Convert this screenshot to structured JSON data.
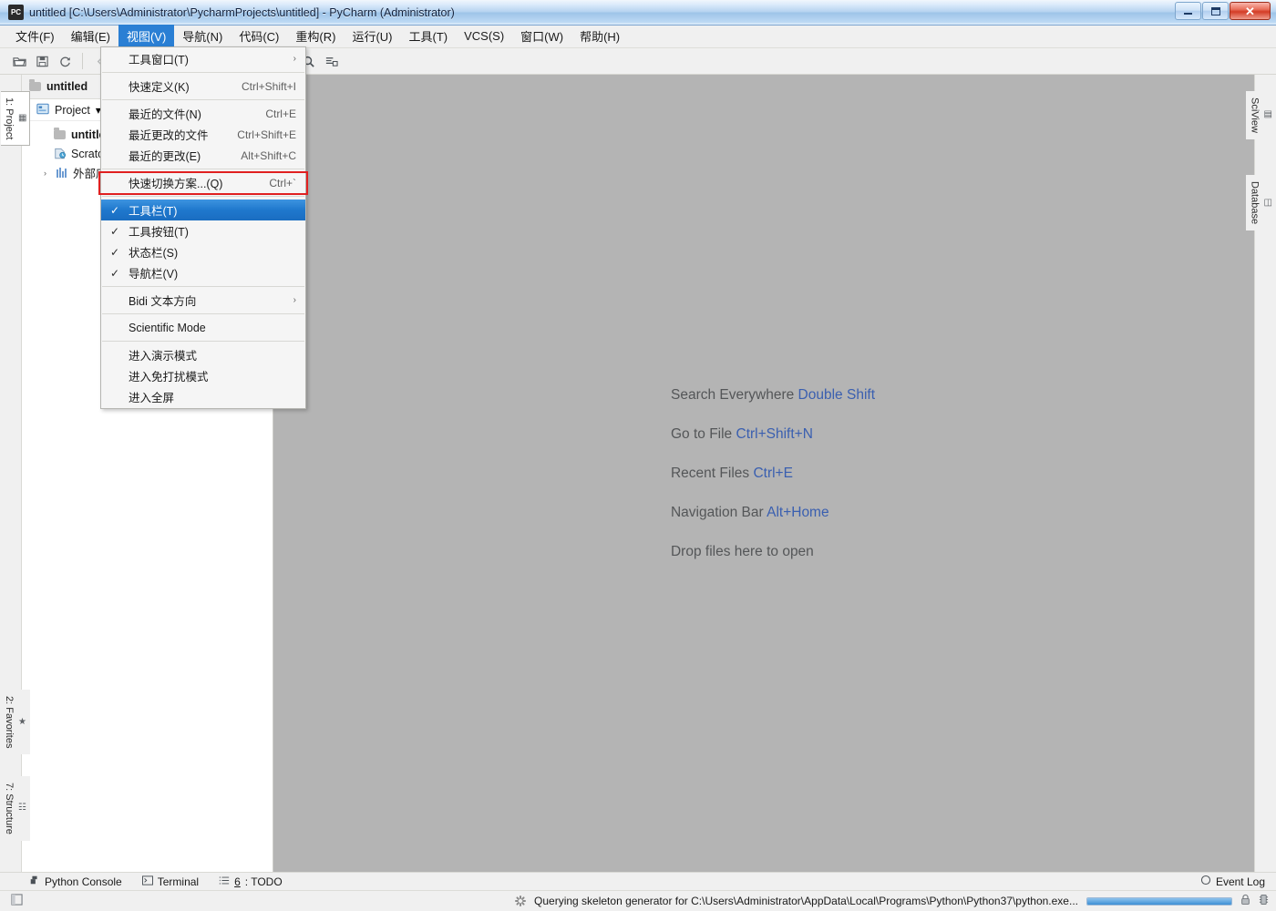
{
  "window": {
    "title": "untitled [C:\\Users\\Administrator\\PycharmProjects\\untitled] - PyCharm (Administrator)",
    "app_icon_label": "PC",
    "minimize_label": "Minimize",
    "maximize_label": "Maximize",
    "close_label": "Close",
    "accent_color": "#2a7fd4",
    "editor_bg": "#b4b4b4"
  },
  "menubar": {
    "items": [
      {
        "label": "文件(F)",
        "active": false
      },
      {
        "label": "编辑(E)",
        "active": false
      },
      {
        "label": "视图(V)",
        "active": true
      },
      {
        "label": "导航(N)",
        "active": false
      },
      {
        "label": "代码(C)",
        "active": false
      },
      {
        "label": "重构(R)",
        "active": false
      },
      {
        "label": "运行(U)",
        "active": false
      },
      {
        "label": "工具(T)",
        "active": false
      },
      {
        "label": "VCS(S)",
        "active": false
      },
      {
        "label": "窗口(W)",
        "active": false
      },
      {
        "label": "帮助(H)",
        "active": false
      }
    ]
  },
  "toolbar": {
    "buttons": [
      {
        "icon": "open-folder-icon",
        "enabled": true
      },
      {
        "icon": "save-icon",
        "enabled": true
      },
      {
        "icon": "sync-refresh-icon",
        "enabled": true
      },
      {
        "icon": "back-arrow-icon",
        "enabled": false
      },
      {
        "icon": "forward-arrow-icon",
        "enabled": false
      },
      {
        "icon": "run-icon",
        "enabled": false
      },
      {
        "icon": "debug-icon",
        "enabled": false
      },
      {
        "icon": "run-coverage-icon",
        "enabled": false
      },
      {
        "icon": "step-icon",
        "enabled": false
      },
      {
        "icon": "stop-icon",
        "enabled": false
      },
      {
        "icon": "wrench-settings-icon",
        "enabled": true
      },
      {
        "icon": "search-icon",
        "enabled": true
      },
      {
        "icon": "project-structure-icon",
        "enabled": true
      }
    ]
  },
  "view_menu": {
    "items": [
      {
        "label": "工具窗口(T)",
        "accel": "",
        "checked": false,
        "submenu": true,
        "highlighted": false,
        "separator_after": true
      },
      {
        "label": "快速定义(K)",
        "accel": "Ctrl+Shift+I",
        "checked": false,
        "submenu": false,
        "highlighted": false,
        "separator_after": true
      },
      {
        "label": "最近的文件(N)",
        "accel": "Ctrl+E",
        "checked": false,
        "submenu": false,
        "highlighted": false,
        "separator_after": false
      },
      {
        "label": "最近更改的文件",
        "accel": "Ctrl+Shift+E",
        "checked": false,
        "submenu": false,
        "highlighted": false,
        "separator_after": false
      },
      {
        "label": "最近的更改(E)",
        "accel": "Alt+Shift+C",
        "checked": false,
        "submenu": false,
        "highlighted": false,
        "separator_after": true
      },
      {
        "label": "快速切换方案...(Q)",
        "accel": "Ctrl+`",
        "checked": false,
        "submenu": false,
        "highlighted": false,
        "separator_after": true
      },
      {
        "label": "工具栏(T)",
        "accel": "",
        "checked": true,
        "submenu": false,
        "highlighted": true,
        "separator_after": false
      },
      {
        "label": "工具按钮(T)",
        "accel": "",
        "checked": true,
        "submenu": false,
        "highlighted": false,
        "separator_after": false
      },
      {
        "label": "状态栏(S)",
        "accel": "",
        "checked": true,
        "submenu": false,
        "highlighted": false,
        "separator_after": false
      },
      {
        "label": "导航栏(V)",
        "accel": "",
        "checked": true,
        "submenu": false,
        "highlighted": false,
        "separator_after": true
      },
      {
        "label": "Bidi 文本方向",
        "accel": "",
        "checked": false,
        "submenu": true,
        "highlighted": false,
        "separator_after": true
      },
      {
        "label": "Scientific Mode",
        "accel": "",
        "checked": false,
        "submenu": false,
        "highlighted": false,
        "separator_after": true
      },
      {
        "label": "进入演示模式",
        "accel": "",
        "checked": false,
        "submenu": false,
        "highlighted": false,
        "separator_after": false
      },
      {
        "label": "进入免打扰模式",
        "accel": "",
        "checked": false,
        "submenu": false,
        "highlighted": false,
        "separator_after": false
      },
      {
        "label": "进入全屏",
        "accel": "",
        "checked": false,
        "submenu": false,
        "highlighted": false,
        "separator_after": false
      }
    ],
    "highlight_color": "#1f78cd",
    "annotation_box_color": "#e02020"
  },
  "left_strip": {
    "items": [
      {
        "label": "1: Project",
        "icon": "project-window-icon",
        "selected": true
      },
      {
        "label": "2: Favorites",
        "icon": "star-icon",
        "selected": false
      },
      {
        "label": "7: Structure",
        "icon": "structure-icon",
        "selected": false
      }
    ]
  },
  "right_strip": {
    "items": [
      {
        "label": "SciView",
        "icon": "sciview-icon"
      },
      {
        "label": "Database",
        "icon": "database-icon"
      }
    ]
  },
  "project_panel": {
    "header_title": "untitled",
    "header_icon": "folder-icon",
    "tab_label": "Project",
    "tab_icon": "project-icon",
    "tree": [
      {
        "label": "untitled",
        "icon": "folder-icon",
        "depth": 1,
        "bold": true,
        "arrow": ""
      },
      {
        "label": "Scratches and Consoles",
        "icon": "scratch-icon",
        "depth": 1,
        "bold": false,
        "arrow": ""
      },
      {
        "label": "外部库",
        "icon": "library-icon",
        "depth": 0,
        "bold": false,
        "arrow": "›"
      }
    ]
  },
  "editor": {
    "hints": [
      {
        "text": "Search Everywhere",
        "key": "Double Shift"
      },
      {
        "text": "Go to File",
        "key": "Ctrl+Shift+N"
      },
      {
        "text": "Recent Files",
        "key": "Ctrl+E"
      },
      {
        "text": "Navigation Bar",
        "key": "Alt+Home"
      },
      {
        "text": "Drop files here to open",
        "key": ""
      }
    ],
    "key_color": "#3a5fb0"
  },
  "bottom_bar": {
    "items": [
      {
        "label": "Python Console",
        "icon": "python-icon",
        "mnemonic": ""
      },
      {
        "label": "Terminal",
        "icon": "terminal-icon",
        "mnemonic": ""
      },
      {
        "label": "6: TODO",
        "icon": "todo-list-icon",
        "mnemonic": "6"
      }
    ],
    "event_log": {
      "label": "Event Log",
      "icon": "event-log-icon"
    }
  },
  "status_bar": {
    "left_icon": "toggle-sidebar-icon",
    "message": "Querying skeleton generator for C:\\Users\\Administrator\\AppData\\Local\\Programs\\Python\\Python37\\python.exe...",
    "progress_percent": 100,
    "progress_color": "#3c8fd4",
    "right_icons": [
      {
        "icon": "lock-icon"
      },
      {
        "icon": "memory-indicator-icon"
      }
    ]
  }
}
